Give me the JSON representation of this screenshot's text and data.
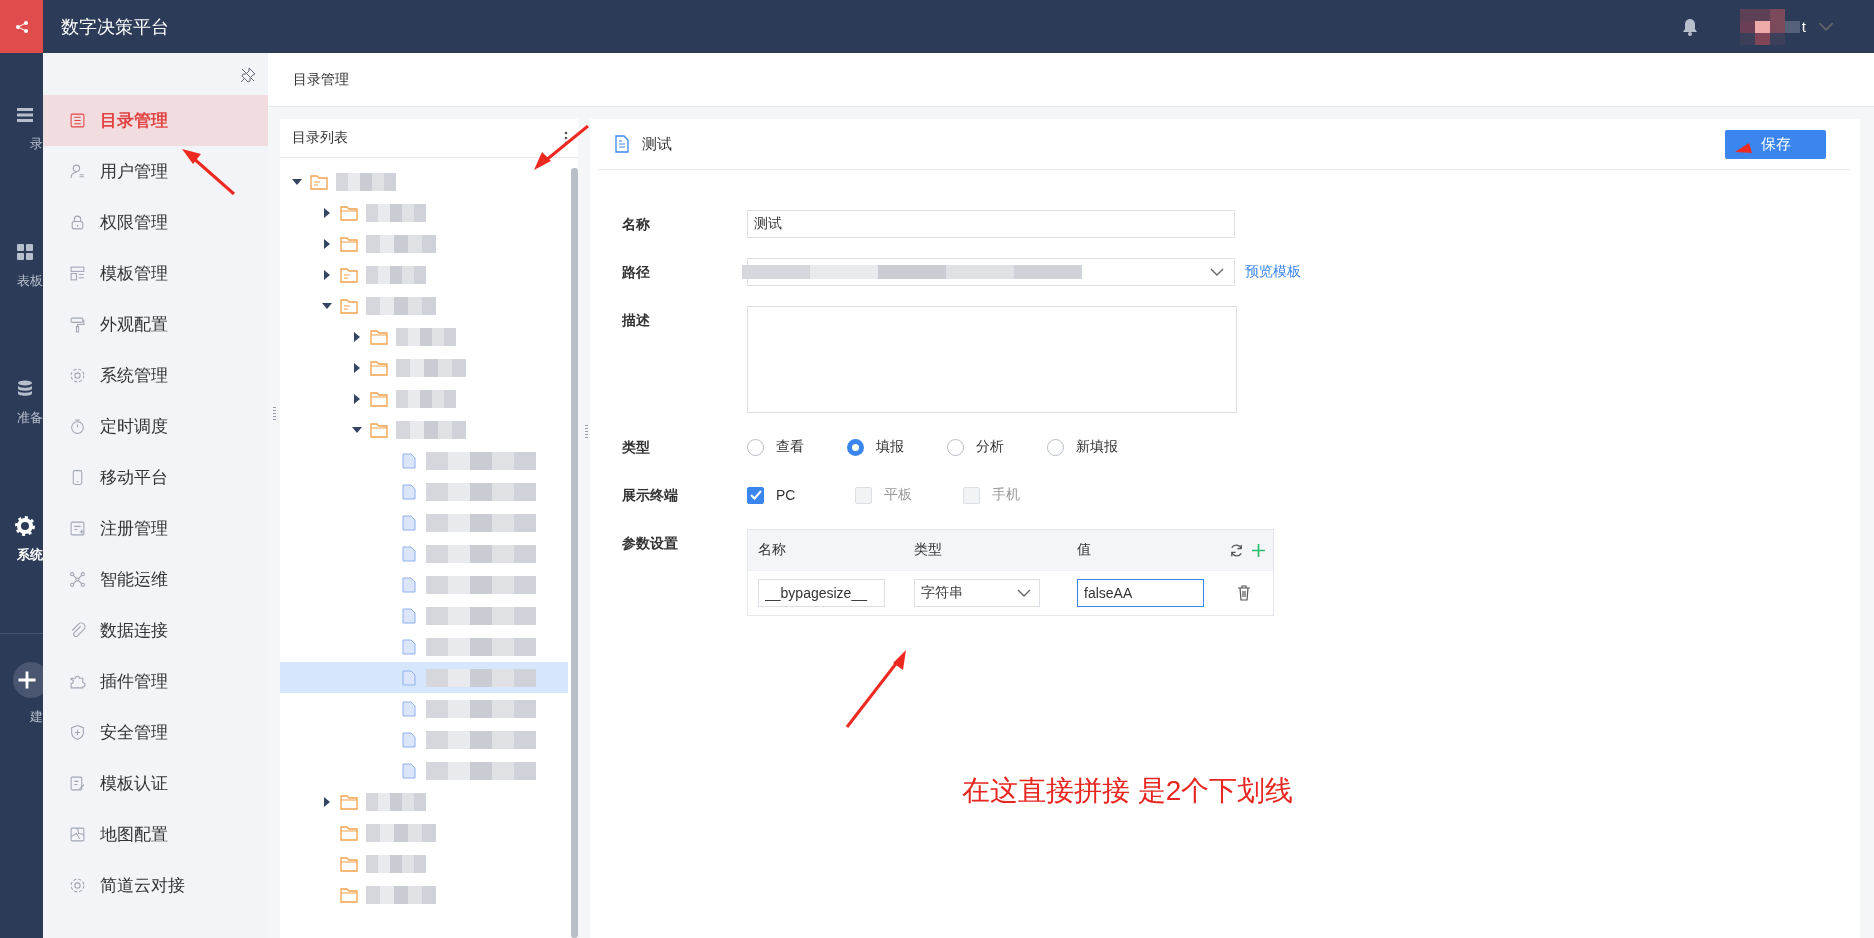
{
  "header": {
    "title": "数字决策平台",
    "user_visible": "t"
  },
  "rail": [
    {
      "label": "录",
      "selected": false,
      "kind": "list"
    },
    {
      "label": "表板",
      "selected": false,
      "kind": "grid"
    },
    {
      "label": "准备",
      "selected": false,
      "kind": "database"
    },
    {
      "label": "系统",
      "selected": true,
      "kind": "gear"
    },
    {
      "label": "建",
      "selected": false,
      "kind": "add"
    }
  ],
  "nav": [
    {
      "label": "目录管理",
      "selected": true
    },
    {
      "label": "用户管理",
      "selected": false
    },
    {
      "label": "权限管理",
      "selected": false
    },
    {
      "label": "模板管理",
      "selected": false
    },
    {
      "label": "外观配置",
      "selected": false
    },
    {
      "label": "系统管理",
      "selected": false
    },
    {
      "label": "定时调度",
      "selected": false
    },
    {
      "label": "移动平台",
      "selected": false
    },
    {
      "label": "注册管理",
      "selected": false
    },
    {
      "label": "智能运维",
      "selected": false
    },
    {
      "label": "数据连接",
      "selected": false
    },
    {
      "label": "插件管理",
      "selected": false
    },
    {
      "label": "安全管理",
      "selected": false
    },
    {
      "label": "模板认证",
      "selected": false
    },
    {
      "label": "地图配置",
      "selected": false
    },
    {
      "label": "简道云对接",
      "selected": false
    }
  ],
  "breadcrumb": "目录管理",
  "tree": {
    "title": "目录列表",
    "nodes": [
      {
        "kind": "folder-doc",
        "expanded": true,
        "selected": false,
        "children": [
          {
            "kind": "folder",
            "expanded": false,
            "selected": false
          },
          {
            "kind": "folder",
            "expanded": false,
            "selected": false
          },
          {
            "kind": "folder-doc",
            "expanded": false,
            "selected": false
          },
          {
            "kind": "folder-doc",
            "expanded": true,
            "selected": false,
            "children": [
              {
                "kind": "folder",
                "expanded": false,
                "selected": false
              },
              {
                "kind": "folder",
                "expanded": false,
                "selected": false
              },
              {
                "kind": "folder",
                "expanded": false,
                "selected": false
              },
              {
                "kind": "folder",
                "expanded": true,
                "selected": false,
                "children": [
                  {
                    "kind": "template",
                    "selected": false
                  },
                  {
                    "kind": "template",
                    "selected": false
                  },
                  {
                    "kind": "template",
                    "selected": false
                  },
                  {
                    "kind": "template",
                    "selected": false
                  },
                  {
                    "kind": "template",
                    "selected": false
                  },
                  {
                    "kind": "template",
                    "selected": false
                  },
                  {
                    "kind": "template",
                    "selected": false
                  },
                  {
                    "kind": "template",
                    "selected": true
                  },
                  {
                    "kind": "template",
                    "selected": false
                  },
                  {
                    "kind": "template",
                    "selected": false
                  },
                  {
                    "kind": "template",
                    "selected": false
                  }
                ]
              }
            ]
          },
          {
            "kind": "folder",
            "expanded": false,
            "selected": false
          },
          {
            "kind": "folder",
            "selected": false
          },
          {
            "kind": "folder",
            "selected": false
          },
          {
            "kind": "folder",
            "selected": false
          }
        ]
      }
    ]
  },
  "detail": {
    "title": "测试",
    "save": "保存",
    "name": {
      "label": "名称",
      "value": "测试"
    },
    "path": {
      "label": "路径",
      "link": "预览模板"
    },
    "description": {
      "label": "描述"
    },
    "type": {
      "label": "类型",
      "options": [
        {
          "label": "查看",
          "selected": false
        },
        {
          "label": "填报",
          "selected": true
        },
        {
          "label": "分析",
          "selected": false
        },
        {
          "label": "新填报",
          "selected": false
        }
      ]
    },
    "terminals": {
      "label": "展示终端",
      "options": [
        {
          "label": "PC",
          "checked": true,
          "disabled": false
        },
        {
          "label": "平板",
          "checked": false,
          "disabled": true
        },
        {
          "label": "手机",
          "checked": false,
          "disabled": true
        }
      ]
    },
    "params": {
      "label": "参数设置",
      "columns": [
        "名称",
        "类型",
        "值"
      ],
      "rows": [
        {
          "name": "__bypagesize__",
          "type": "字符串",
          "value": "falseAA",
          "value_focused": true
        }
      ]
    }
  },
  "annotation": {
    "text": "在这直接拼接 是2个下划线"
  }
}
